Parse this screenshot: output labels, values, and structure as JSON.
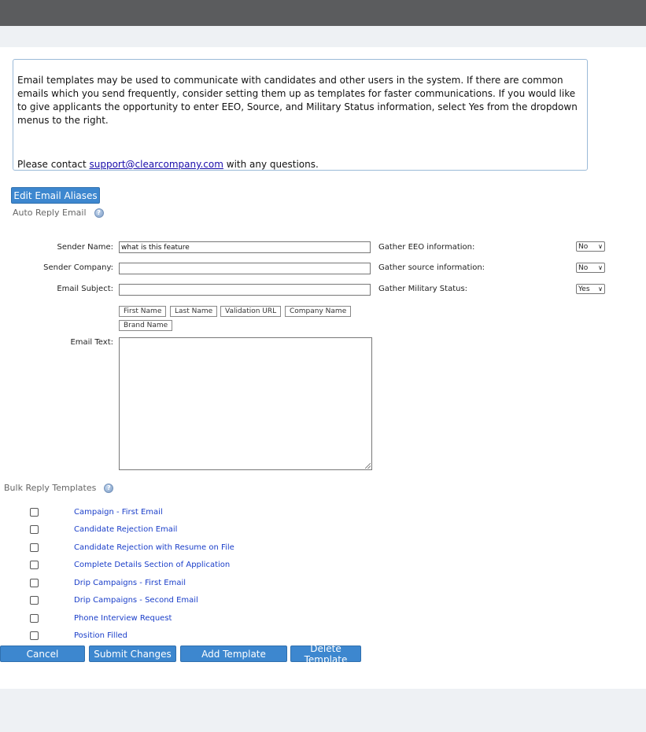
{
  "info": {
    "paragraph": "Email templates may be used to communicate with candidates and other users in the system. If there are common emails which you send frequently, consider setting them up as templates for faster communications. If you would like to give applicants the opportunity to enter EEO, Source, and Military Status information, select Yes from the dropdown menus to the right.",
    "contact_prefix": "Please contact ",
    "contact_email": "support@clearcompany.com",
    "contact_suffix": " with any questions."
  },
  "edit_aliases_label": "Edit Email Aliases",
  "auto_reply": {
    "title": "Auto Reply Email",
    "sender_name_label": "Sender Name:",
    "sender_name_value": "what is this feature",
    "sender_company_label": "Sender Company:",
    "sender_company_value": "",
    "email_subject_label": "Email Subject:",
    "email_subject_value": "",
    "email_text_label": "Email Text:",
    "tags": [
      "First Name",
      "Last Name",
      "Validation URL",
      "Company Name",
      "Brand Name"
    ],
    "gather_eeo_label": "Gather EEO information:",
    "gather_eeo_value": "No",
    "gather_source_label": "Gather source information:",
    "gather_source_value": "No",
    "gather_military_label": "Gather Military Status:",
    "gather_military_value": "Yes"
  },
  "bulk": {
    "title": "Bulk Reply Templates",
    "templates": [
      "Campaign - First Email",
      "Candidate Rejection Email",
      "Candidate Rejection with Resume on File",
      "Complete Details Section of Application",
      "Drip Campaigns - First Email",
      "Drip Campaigns - Second Email",
      "Phone Interview Request",
      "Position Filled"
    ]
  },
  "actions": {
    "cancel": "Cancel",
    "submit": "Submit Changes",
    "add": "Add Template",
    "delete": "Delete Template"
  },
  "colors": {
    "button": "#3d87cf",
    "link": "#1a3ec9",
    "topbar": "#5b5c5e"
  }
}
